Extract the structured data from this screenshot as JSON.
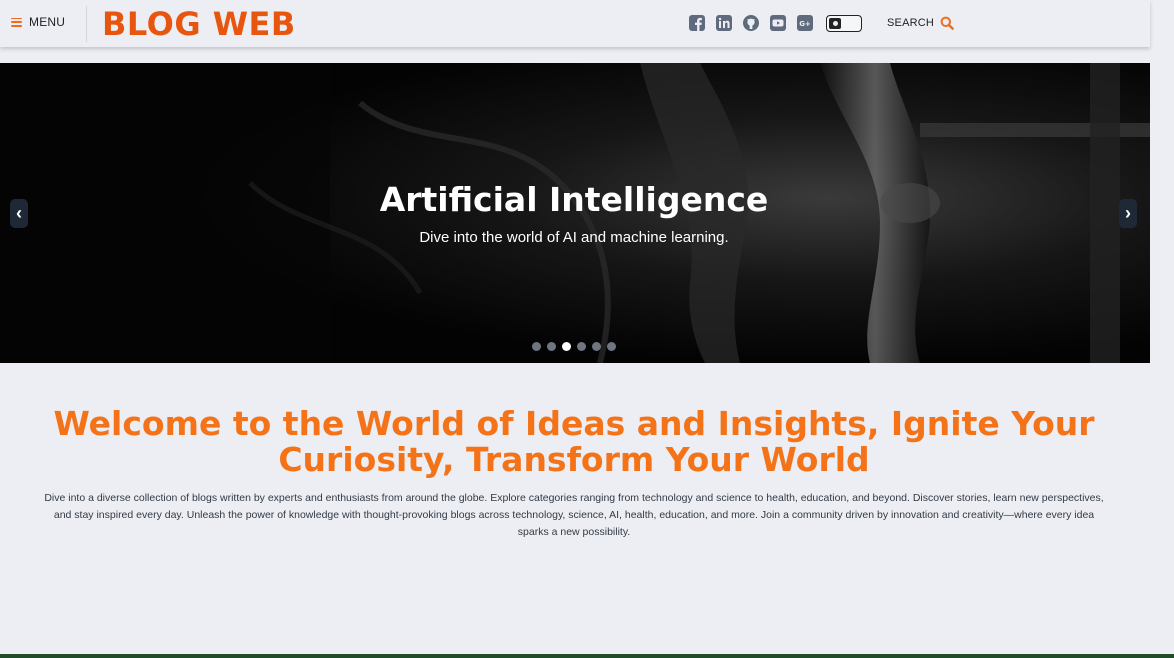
{
  "header": {
    "menu_label": "MENU",
    "logo": "BLOG WEB",
    "search_label": "SEARCH",
    "socials": [
      {
        "icon": "facebook-icon"
      },
      {
        "icon": "linkedin-icon"
      },
      {
        "icon": "github-icon"
      },
      {
        "icon": "youtube-icon"
      },
      {
        "icon": "google-plus-icon"
      }
    ]
  },
  "hero": {
    "title": "Artificial Intelligence",
    "subtitle": "Dive into the world of AI and machine learning.",
    "prev_label": "‹",
    "next_label": "›",
    "slide_count": 6,
    "active_slide": 3
  },
  "welcome": {
    "title": "Welcome to the World of Ideas and Insights, Ignite Your Curiosity, Transform Your World",
    "body": "Dive into a diverse collection of blogs written by experts and enthusiasts from around the globe. Explore categories ranging from technology and science to health, education, and beyond. Discover stories, learn new perspectives, and stay inspired every day. Unleash the power of knowledge with thought-provoking blogs across technology, science, AI, health, education, and more. Join a community driven by innovation and creativity—where every idea sparks a new possibility."
  },
  "colors": {
    "accent": "#e8550e",
    "heading": "#f47318",
    "background": "#eceef3",
    "icon": "#5f6b7c"
  }
}
